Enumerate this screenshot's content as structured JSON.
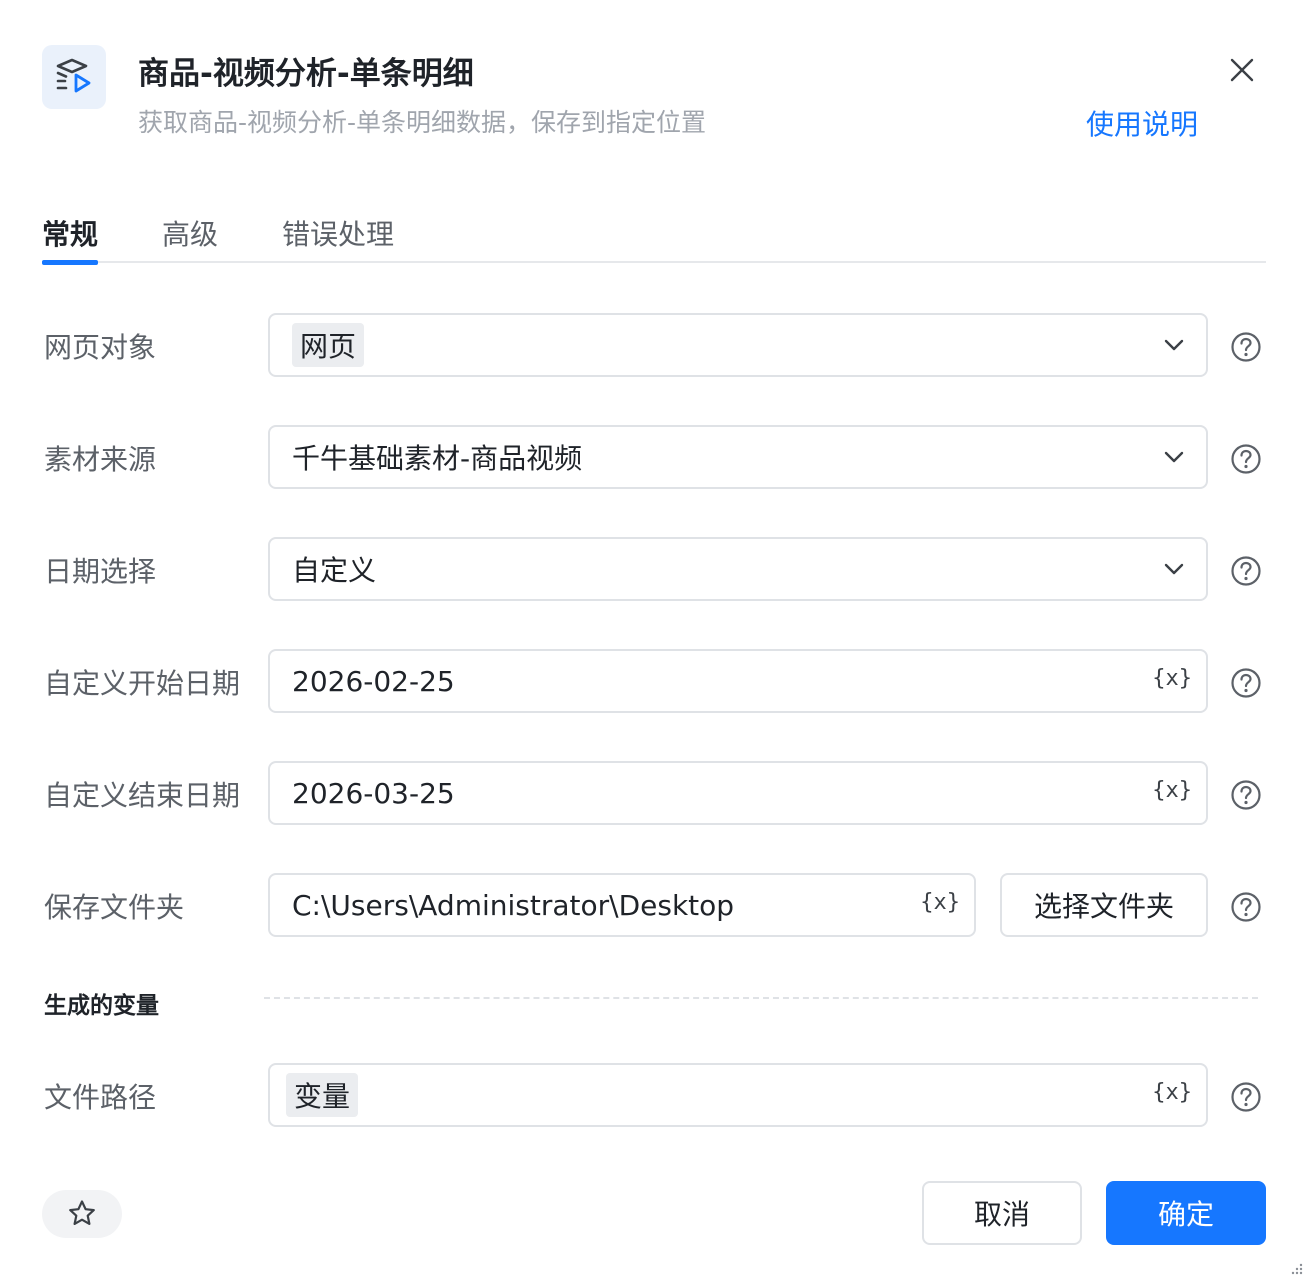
{
  "header": {
    "icon": "layers-play-icon",
    "title": "商品-视频分析-单条明细",
    "subtitle": "获取商品-视频分析-单条明细数据，保存到指定位置",
    "help_link": "使用说明",
    "close_icon": "close-icon"
  },
  "tabs": [
    {
      "label": "常规",
      "active": true
    },
    {
      "label": "高级",
      "active": false
    },
    {
      "label": "错误处理",
      "active": false
    }
  ],
  "form": {
    "webpage": {
      "label": "网页对象",
      "value": "网页"
    },
    "source": {
      "label": "素材来源",
      "value": "千牛基础素材-商品视频"
    },
    "date_select": {
      "label": "日期选择",
      "value": "自定义"
    },
    "start_date": {
      "label": "自定义开始日期",
      "value": "2026-02-25"
    },
    "end_date": {
      "label": "自定义结束日期",
      "value": "2026-03-25"
    },
    "save_folder": {
      "label": "保存文件夹",
      "value": "C:\\Users\\Administrator\\Desktop",
      "pick_button": "选择文件夹"
    }
  },
  "variables": {
    "section_title": "生成的变量",
    "file_path": {
      "label": "文件路径",
      "value": "变量"
    }
  },
  "variable_icon_text": "{x}",
  "footer": {
    "cancel": "取消",
    "confirm": "确定"
  },
  "colors": {
    "accent": "#1677ff",
    "border": "#dfe2e6",
    "label": "#5c6168"
  }
}
